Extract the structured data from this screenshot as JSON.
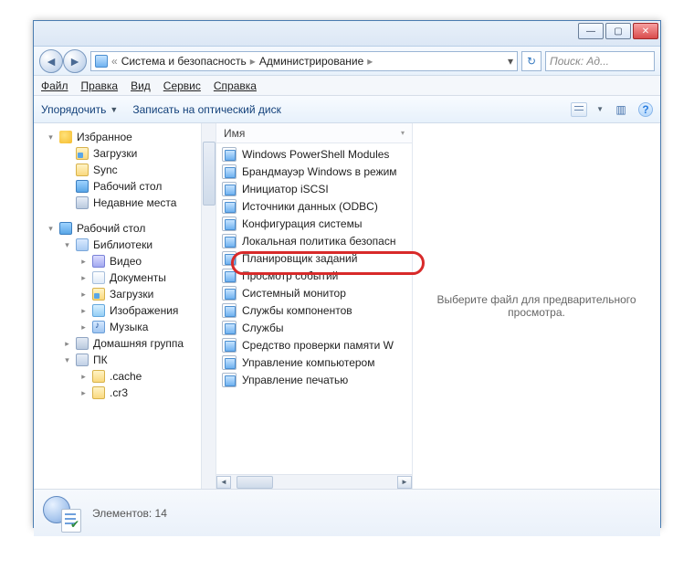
{
  "breadcrumb": {
    "icon": "control-panel",
    "seg1": "Система и безопасность",
    "seg2": "Администрирование"
  },
  "search": {
    "placeholder": "Поиск: Ад..."
  },
  "menubar": {
    "file": "Файл",
    "edit": "Правка",
    "view": "Вид",
    "tools": "Сервис",
    "help": "Справка"
  },
  "toolbar": {
    "organize": "Упорядочить",
    "burn": "Записать на оптический диск"
  },
  "columns": {
    "name": "Имя"
  },
  "nav": {
    "favorites": {
      "label": "Избранное",
      "items": [
        {
          "icon": "fld",
          "label": "Загрузки"
        },
        {
          "icon": "fld",
          "label": "Sync"
        },
        {
          "icon": "desk",
          "label": "Рабочий стол"
        },
        {
          "icon": "places",
          "label": "Недавние места"
        }
      ]
    },
    "desktop": {
      "label": "Рабочий стол",
      "libraries": {
        "label": "Библиотеки",
        "items": [
          {
            "icon": "vid",
            "label": "Видео"
          },
          {
            "icon": "doc",
            "label": "Документы"
          },
          {
            "icon": "fld",
            "label": "Загрузки"
          },
          {
            "icon": "pic",
            "label": "Изображения"
          },
          {
            "icon": "mus",
            "label": "Музыка"
          }
        ]
      },
      "homegroup": {
        "label": "Домашняя группа"
      },
      "pc": {
        "label": "ПК",
        "items": [
          {
            "icon": "fld",
            "label": ".cache"
          },
          {
            "icon": "fld",
            "label": ".cr3"
          }
        ]
      }
    }
  },
  "files": [
    {
      "label": "Windows PowerShell Modules"
    },
    {
      "label": "Брандмауэр Windows в режим"
    },
    {
      "label": "Инициатор iSCSI"
    },
    {
      "label": "Источники данных (ODBC)"
    },
    {
      "label": "Конфигурация системы",
      "highlighted": true
    },
    {
      "label": "Локальная политика безопасн"
    },
    {
      "label": "Планировщик заданий"
    },
    {
      "label": "Просмотр событий"
    },
    {
      "label": "Системный монитор"
    },
    {
      "label": "Службы компонентов"
    },
    {
      "label": "Службы"
    },
    {
      "label": "Средство проверки памяти W"
    },
    {
      "label": "Управление компьютером"
    },
    {
      "label": "Управление печатью"
    }
  ],
  "preview": {
    "empty_text": "Выберите файл для предварительного просмотра."
  },
  "status": {
    "count_label": "Элементов: 14"
  }
}
